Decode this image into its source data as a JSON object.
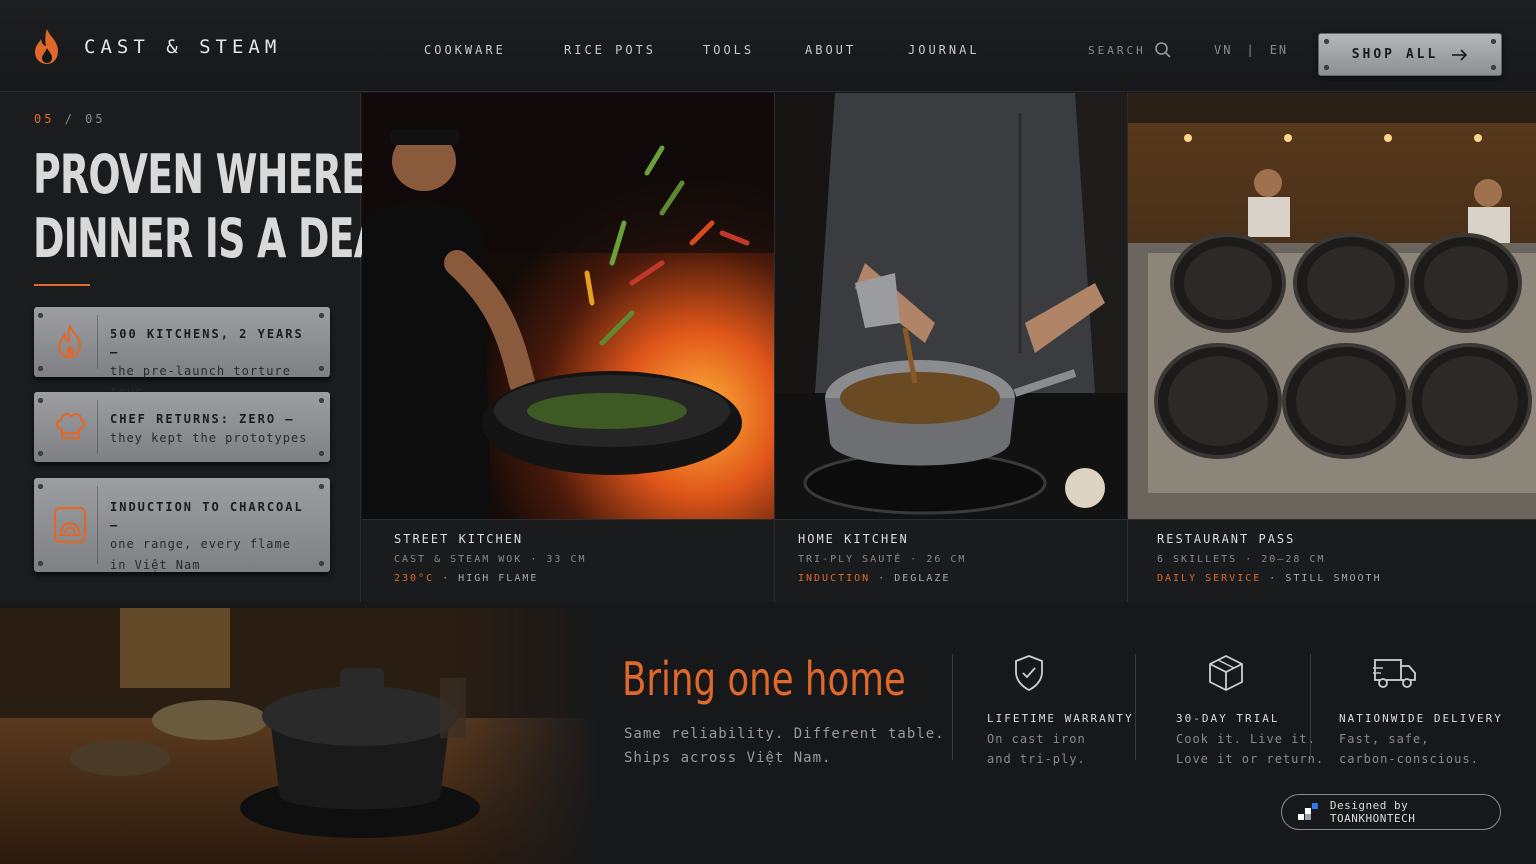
{
  "brand": {
    "name": "CAST & STEAM",
    "accent": "#e0682a"
  },
  "nav": {
    "items": [
      "COOKWARE",
      "RICE POTS",
      "TOOLS",
      "ABOUT",
      "JOURNAL"
    ]
  },
  "header": {
    "search_label": "SEARCH",
    "lang_vn": "VN",
    "lang_sep": "|",
    "lang_en": "EN",
    "shop_label": "SHOP ALL"
  },
  "slide": {
    "current": "05",
    "sep": "/",
    "total": "05"
  },
  "hero": {
    "line1": "PROVEN WHERE",
    "line2": "DINNER IS A DEADLINE."
  },
  "proofs": [
    {
      "icon": "flame-icon",
      "title": "500 KITCHENS, 2 YEARS —",
      "body": "the pre-launch torture tour",
      "body2": ""
    },
    {
      "icon": "chef-hat-icon",
      "title": "CHEF RETURNS: ZERO —",
      "body": "they kept the prototypes",
      "body2": ""
    },
    {
      "icon": "stove-icon",
      "title": "INDUCTION TO CHARCOAL —",
      "body": "one range, every flame",
      "body2": "in Việt Nam"
    }
  ],
  "panels": [
    {
      "title": "STREET KITCHEN",
      "sub": "CAST & STEAM WOK · 33 CM",
      "hl": "230°C",
      "meta": " · HIGH FLAME"
    },
    {
      "title": "HOME KITCHEN",
      "sub": "TRI-PLY SAUTÉ · 26 CM",
      "hl": "INDUCTION",
      "meta": " · DEGLAZE"
    },
    {
      "title": "RESTAURANT PASS",
      "sub": "6 SKILLETS · 20–28 CM",
      "hl": "DAILY SERVICE",
      "meta": " · STILL SMOOTH"
    }
  ],
  "cta": {
    "title": "Bring one home",
    "sub1": "Same reliability. Different table.",
    "sub2": "Ships across Việt Nam."
  },
  "features": [
    {
      "icon": "shield-check-icon",
      "title": "LIFETIME WARRANTY",
      "body1": "On cast iron",
      "body2": "and tri-ply."
    },
    {
      "icon": "box-icon",
      "title": "30-DAY TRIAL",
      "body1": "Cook it. Live it.",
      "body2": "Love it or return."
    },
    {
      "icon": "truck-icon",
      "title": "NATIONWIDE DELIVERY",
      "body1": "Fast, safe,",
      "body2": "carbon-conscious."
    }
  ],
  "credit": {
    "label": "Designed by TOANKHONTECH"
  }
}
